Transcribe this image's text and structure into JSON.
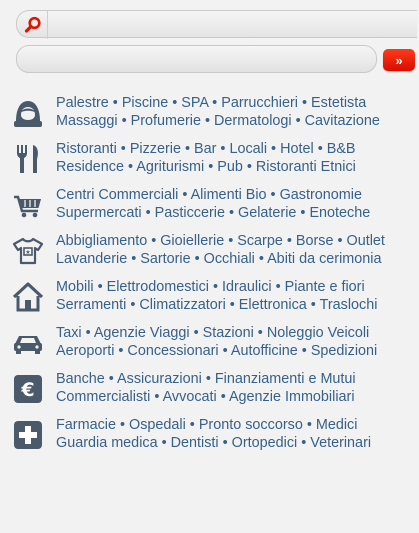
{
  "search": {
    "placeholder": ""
  },
  "location": {
    "placeholder": ""
  },
  "go_button": {
    "label": "»"
  },
  "categories": [
    {
      "icon": "beauty-face-icon",
      "line1": "Palestre • Piscine • SPA • Parrucchieri • Estetista",
      "line2": "Massaggi • Profumerie • Dermatologi • Cavitazione"
    },
    {
      "icon": "fork-knife-icon",
      "line1": "Ristoranti • Pizzerie • Bar • Locali • Hotel • B&B",
      "line2": "Residence • Agriturismi • Pub • Ristoranti Etnici"
    },
    {
      "icon": "shopping-cart-icon",
      "line1": "Centri Commerciali • Alimenti Bio • Gastronomie",
      "line2": "Supermercati • Pasticcerie • Gelaterie • Enoteche"
    },
    {
      "icon": "tshirt-icon",
      "line1": "Abbigliamento • Gioiellerie • Scarpe • Borse • Outlet",
      "line2": "Lavanderie • Sartorie • Occhiali • Abiti da cerimonia"
    },
    {
      "icon": "house-icon",
      "line1": "Mobili • Elettrodomestici • Idraulici • Piante e fiori",
      "line2": "Serramenti • Climatizzatori • Elettronica • Traslochi"
    },
    {
      "icon": "car-icon",
      "line1": "Taxi • Agenzie Viaggi • Stazioni • Noleggio Veicoli",
      "line2": "Aeroporti • Concessionari • Autofficine • Spedizioni"
    },
    {
      "icon": "euro-icon",
      "line1": "Banche • Assicurazioni • Finanziamenti e Mutui",
      "line2": "Commercialisti • Avvocati • Agenzie Immobiliari"
    },
    {
      "icon": "medical-cross-icon",
      "line1": "Farmacie • Ospedali • Pronto soccorso • Medici",
      "line2": "Guardia medica • Dentisti • Ortopedici • Veterinari"
    }
  ],
  "colors": {
    "link": "#37618a",
    "icon": "#4a5a6b",
    "accent": "#e01400"
  }
}
